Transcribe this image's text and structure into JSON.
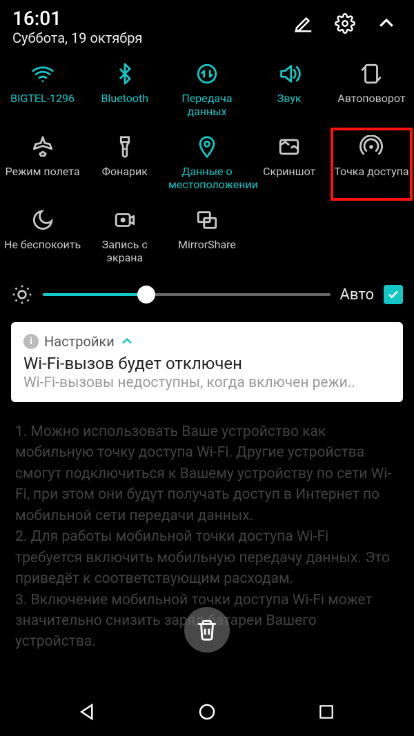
{
  "status": {
    "time": "16:01",
    "date": "Суббота, 19 октября"
  },
  "colors": {
    "accent": "#14c7c7"
  },
  "tiles": [
    {
      "label": "BIGTEL-1296",
      "icon": "wifi-icon",
      "active": true
    },
    {
      "label": "Bluetooth",
      "icon": "bluetooth-icon",
      "active": true
    },
    {
      "label": "Передача данных",
      "icon": "data-transfer-icon",
      "active": true
    },
    {
      "label": "Звук",
      "icon": "sound-icon",
      "active": true
    },
    {
      "label": "Автоповорот",
      "icon": "auto-rotate-icon",
      "active": false
    },
    {
      "label": "Режим полета",
      "icon": "airplane-icon",
      "active": false
    },
    {
      "label": "Фонарик",
      "icon": "flashlight-icon",
      "active": false
    },
    {
      "label": "Данные о местоположении",
      "icon": "location-icon",
      "active": true
    },
    {
      "label": "Скриншот",
      "icon": "screenshot-icon",
      "active": false
    },
    {
      "label": "Точка доступа",
      "icon": "hotspot-icon",
      "active": false,
      "highlight": true
    },
    {
      "label": "Не беспокоить",
      "icon": "dnd-icon",
      "active": false
    },
    {
      "label": "Запись с экрана",
      "icon": "screen-record-icon",
      "active": false
    },
    {
      "label": "MirrorShare",
      "icon": "mirror-share-icon",
      "active": false
    }
  ],
  "brightness": {
    "auto_label": "Авто",
    "auto_checked": true,
    "value": 36
  },
  "notification": {
    "app_name": "Настройки",
    "title": "Wi-Fi-вызов будет отключен",
    "body": "Wi-Fi-вызовы недоступны, когда включен режи.."
  },
  "background_text": "1. Можно использовать Ваше устройство как мобильную точку доступа Wi-Fi. Другие устройства смогут подключиться к Вашему устройству по сети Wi-Fi, при этом они будут получать доступ в Интернет по мобильной сети передачи данных.\n2. Для работы мобильной точки доступа Wi-Fi требуется включить мобильную передачу данных. Это приведёт к соответствующим расходам.\n3. Включение мобильной точки доступа Wi-Fi может значительно снизить заряд батареи Вашего устройства."
}
